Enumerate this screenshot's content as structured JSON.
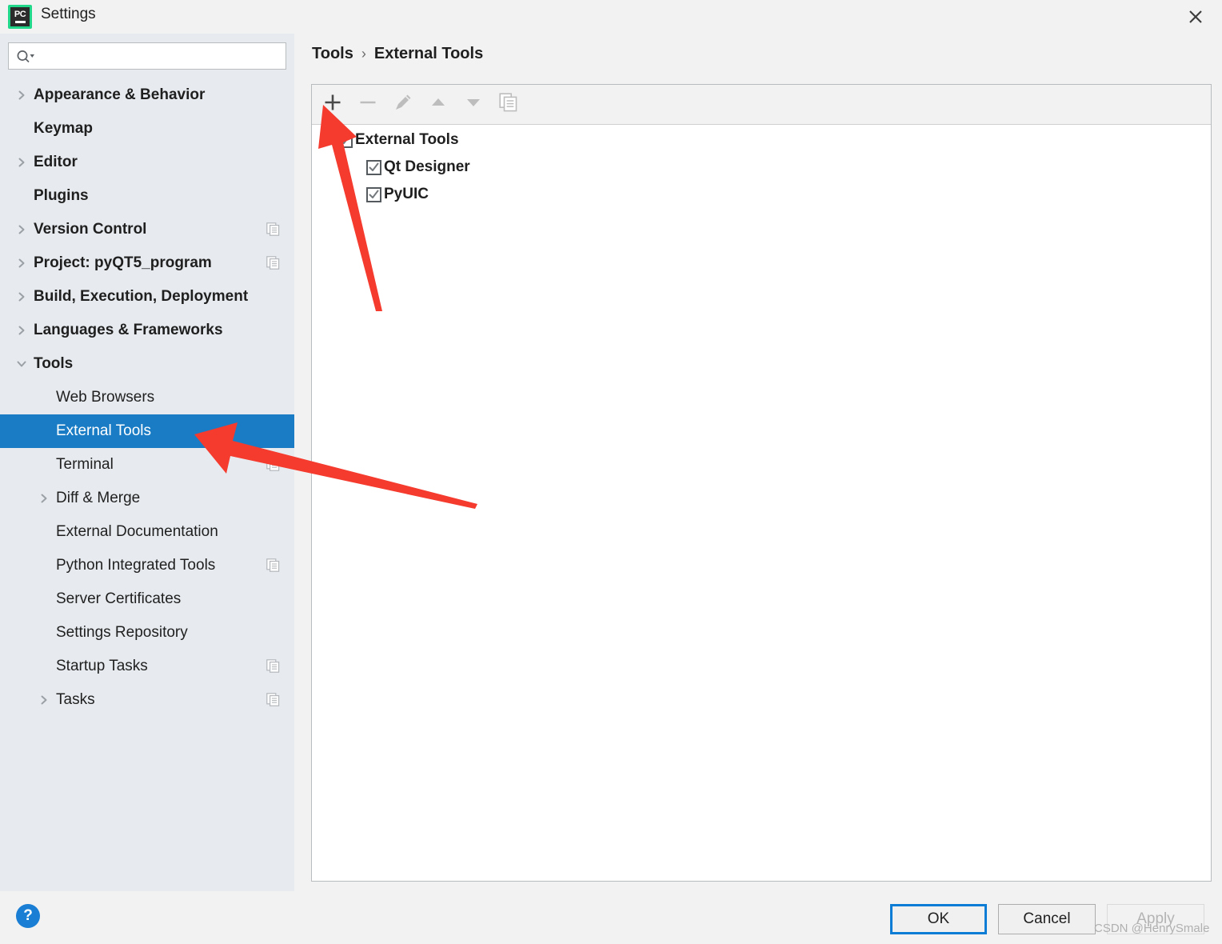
{
  "window": {
    "title": "Settings",
    "app_icon": "pycharm-icon",
    "close_icon": "close-icon"
  },
  "search": {
    "value": "",
    "placeholder": "",
    "icon": "search-icon",
    "dropdown_icon": "chevron-down-icon"
  },
  "sidebar": {
    "items": [
      {
        "label": "Appearance & Behavior",
        "level": 0,
        "twisty": "chevron-right",
        "copy_icon": false,
        "selected": false
      },
      {
        "label": "Keymap",
        "level": 0,
        "twisty": "none",
        "copy_icon": false,
        "selected": false
      },
      {
        "label": "Editor",
        "level": 0,
        "twisty": "chevron-right",
        "copy_icon": false,
        "selected": false
      },
      {
        "label": "Plugins",
        "level": 0,
        "twisty": "none",
        "copy_icon": false,
        "selected": false
      },
      {
        "label": "Version Control",
        "level": 0,
        "twisty": "chevron-right",
        "copy_icon": true,
        "selected": false
      },
      {
        "label": "Project: pyQT5_program",
        "level": 0,
        "twisty": "chevron-right",
        "copy_icon": true,
        "selected": false
      },
      {
        "label": "Build, Execution, Deployment",
        "level": 0,
        "twisty": "chevron-right",
        "copy_icon": false,
        "selected": false
      },
      {
        "label": "Languages & Frameworks",
        "level": 0,
        "twisty": "chevron-right",
        "copy_icon": false,
        "selected": false
      },
      {
        "label": "Tools",
        "level": 0,
        "twisty": "chevron-down",
        "copy_icon": false,
        "selected": false
      },
      {
        "label": "Web Browsers",
        "level": 1,
        "twisty": "none",
        "copy_icon": false,
        "selected": false
      },
      {
        "label": "External Tools",
        "level": 1,
        "twisty": "none",
        "copy_icon": false,
        "selected": true
      },
      {
        "label": "Terminal",
        "level": 1,
        "twisty": "none",
        "copy_icon": true,
        "selected": false
      },
      {
        "label": "Diff & Merge",
        "level": 1,
        "twisty": "chevron-right",
        "copy_icon": false,
        "selected": false
      },
      {
        "label": "External Documentation",
        "level": 1,
        "twisty": "none",
        "copy_icon": false,
        "selected": false
      },
      {
        "label": "Python Integrated Tools",
        "level": 1,
        "twisty": "none",
        "copy_icon": true,
        "selected": false
      },
      {
        "label": "Server Certificates",
        "level": 1,
        "twisty": "none",
        "copy_icon": false,
        "selected": false
      },
      {
        "label": "Settings Repository",
        "level": 1,
        "twisty": "none",
        "copy_icon": false,
        "selected": false
      },
      {
        "label": "Startup Tasks",
        "level": 1,
        "twisty": "none",
        "copy_icon": true,
        "selected": false
      },
      {
        "label": "Tasks",
        "level": 1,
        "twisty": "chevron-right",
        "copy_icon": true,
        "selected": false
      }
    ]
  },
  "main": {
    "breadcrumb": {
      "parent": "Tools",
      "separator": "›",
      "current": "External Tools"
    },
    "toolbar": [
      {
        "name": "add-button",
        "icon": "plus-icon",
        "enabled": true
      },
      {
        "name": "remove-button",
        "icon": "minus-icon",
        "enabled": false
      },
      {
        "name": "edit-button",
        "icon": "pencil-icon",
        "enabled": false
      },
      {
        "name": "move-up-button",
        "icon": "triangle-up-icon",
        "enabled": false
      },
      {
        "name": "move-down-button",
        "icon": "triangle-down-icon",
        "enabled": false
      },
      {
        "name": "copy-button",
        "icon": "copy-icon",
        "enabled": false
      }
    ],
    "tool_tree": {
      "root": {
        "label": "External Tools",
        "checked": true,
        "expanded": true
      },
      "children": [
        {
          "label": "Qt Designer",
          "checked": true
        },
        {
          "label": "PyUIC",
          "checked": true
        }
      ]
    }
  },
  "footer": {
    "help_label": "?",
    "ok_label": "OK",
    "cancel_label": "Cancel",
    "apply_label": "Apply"
  },
  "watermark": {
    "text": "CSDN @HenrySmale"
  },
  "colors": {
    "selection_blue": "#1a7cc4",
    "sidebar_bg": "#e7ebef",
    "dialog_bg": "#f2f2f2",
    "focus_border": "#0c7cd5",
    "annotation_red": "#f53a2e",
    "help_blue": "#1a7fd4",
    "pycharm_green": "#21d789"
  }
}
